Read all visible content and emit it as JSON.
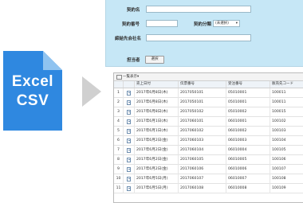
{
  "file_badge": {
    "line1": "Excel",
    "line2": "CSV",
    "color": "#2f88e0",
    "fold_color": "#8fc3f0"
  },
  "arrow_color": "#d0d0d0",
  "form": {
    "bg": "#c6e7f6",
    "contract_name_label": "契約名",
    "contract_no_label": "契約番号",
    "contract_category_label": "契約分類",
    "contract_category_value": "(未選択)",
    "partner_name_label": "締結先会社名",
    "owner_label": "担当者",
    "select_button": "選択"
  },
  "table": {
    "toolbar_label": "一覧表示▾",
    "columns": [
      "",
      "",
      "売上日付",
      "伝票番号",
      "受注番号",
      "販売先コード"
    ],
    "rows": [
      {
        "no": "1",
        "date": "2017年6月8日(木)",
        "slip": "2017050101",
        "order": "05010001",
        "code": "100011"
      },
      {
        "no": "2",
        "date": "2017年6月8日(木)",
        "slip": "2017050101",
        "order": "05010001",
        "code": "100011"
      },
      {
        "no": "3",
        "date": "2017年6月8日(木)",
        "slip": "2017050102",
        "order": "05010002",
        "code": "100015"
      },
      {
        "no": "4",
        "date": "2017年6月1日(木)",
        "slip": "2017060101",
        "order": "06010001",
        "code": "100102"
      },
      {
        "no": "5",
        "date": "2017年6月1日(木)",
        "slip": "2017060102",
        "order": "06010002",
        "code": "100103"
      },
      {
        "no": "6",
        "date": "2017年6月2日(金)",
        "slip": "2017060103",
        "order": "06010003",
        "code": "100104"
      },
      {
        "no": "7",
        "date": "2017年6月2日(金)",
        "slip": "2017060104",
        "order": "06010004",
        "code": "100105"
      },
      {
        "no": "8",
        "date": "2017年6月2日(金)",
        "slip": "2017060105",
        "order": "06010005",
        "code": "100106"
      },
      {
        "no": "9",
        "date": "2017年6月2日(金)",
        "slip": "2017060106",
        "order": "06010006",
        "code": "100107"
      },
      {
        "no": "10",
        "date": "2017年6月5日(月)",
        "slip": "2017060107",
        "order": "06010007",
        "code": "100108"
      },
      {
        "no": "11",
        "date": "2017年6月5日(月)",
        "slip": "2017060108",
        "order": "06010008",
        "code": "100109"
      }
    ]
  }
}
